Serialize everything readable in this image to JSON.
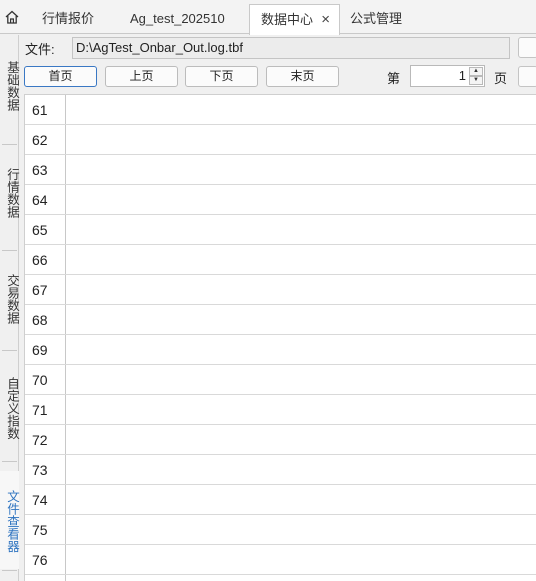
{
  "tabs": [
    {
      "label": "行情报价"
    },
    {
      "label": "Ag_test_202510"
    },
    {
      "label": "数据中心",
      "active": true,
      "close": "×"
    },
    {
      "label": "公式管理"
    }
  ],
  "icons": {
    "home": "home-icon",
    "close": "close-icon",
    "spin_up": "chevron-up-icon",
    "spin_down": "chevron-down-icon"
  },
  "sidebar": {
    "items": [
      {
        "label": "基础数据"
      },
      {
        "label": "行情数据"
      },
      {
        "label": "交易数据"
      },
      {
        "label": "自定义指数"
      },
      {
        "label": "文件查看器",
        "active": true
      }
    ]
  },
  "file": {
    "label": "文件:",
    "path": "D:\\AgTest_Onbar_Out.log.tbf"
  },
  "pager": {
    "first": "首页",
    "prev": "上页",
    "next": "下页",
    "last": "末页",
    "page_prefix": "第",
    "page_value": "1",
    "page_suffix": "页"
  },
  "rows": [
    "61",
    "62",
    "63",
    "64",
    "65",
    "66",
    "67",
    "68",
    "69",
    "70",
    "71",
    "72",
    "73",
    "74",
    "75",
    "76"
  ],
  "colors": {
    "accent": "#2f74c0",
    "border": "#c9c9c9"
  }
}
